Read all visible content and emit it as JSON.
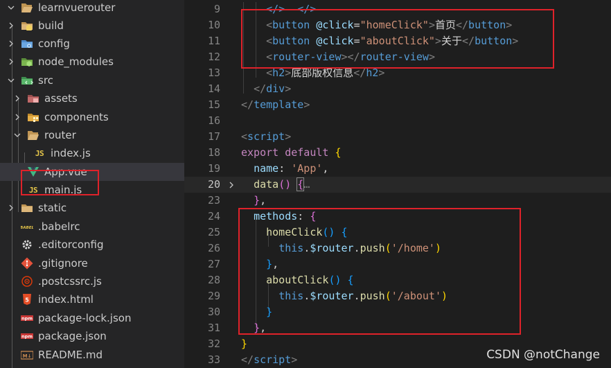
{
  "explorer": {
    "items": [
      {
        "label": "learnvuerouter",
        "chevron": "down",
        "icon": "folder-open-icon"
      },
      {
        "label": "build",
        "chevron": "right",
        "icon": "folder-build-icon"
      },
      {
        "label": "config",
        "chevron": "right",
        "icon": "folder-config-icon"
      },
      {
        "label": "node_modules",
        "chevron": "right",
        "icon": "folder-node-icon"
      },
      {
        "label": "src",
        "chevron": "down",
        "icon": "folder-src-icon"
      },
      {
        "label": "assets",
        "chevron": "right",
        "icon": "folder-assets-icon"
      },
      {
        "label": "components",
        "chevron": "right",
        "icon": "folder-components-icon"
      },
      {
        "label": "router",
        "chevron": "down",
        "icon": "folder-open-icon"
      },
      {
        "label": "index.js",
        "chevron": "",
        "icon": "js-file-icon",
        "badge": "JS"
      },
      {
        "label": "App.vue",
        "chevron": "",
        "icon": "vue-file-icon",
        "selected": true
      },
      {
        "label": "main.js",
        "chevron": "",
        "icon": "js-file-icon",
        "badge": "JS"
      },
      {
        "label": "static",
        "chevron": "right",
        "icon": "folder-icon"
      },
      {
        "label": ".babelrc",
        "chevron": "",
        "icon": "babel-file-icon",
        "badge": "BABEL"
      },
      {
        "label": ".editorconfig",
        "chevron": "",
        "icon": "gear-file-icon"
      },
      {
        "label": ".gitignore",
        "chevron": "",
        "icon": "git-file-icon"
      },
      {
        "label": ".postcssrc.js",
        "chevron": "",
        "icon": "postcss-file-icon"
      },
      {
        "label": "index.html",
        "chevron": "",
        "icon": "html-file-icon",
        "badge": "5"
      },
      {
        "label": "package-lock.json",
        "chevron": "",
        "icon": "npm-file-icon",
        "badge": "npm"
      },
      {
        "label": "package.json",
        "chevron": "",
        "icon": "npm-file-icon",
        "badge": "npm"
      },
      {
        "label": "README.md",
        "chevron": "",
        "icon": "markdown-file-icon",
        "badge": "M↓"
      }
    ]
  },
  "editor": {
    "lines": [
      {
        "n": "9",
        "tokens": [
          [
            "    ",
            "plain"
          ],
          [
            "</",
            "tag"
          ],
          [
            ">",
            "tag"
          ],
          [
            "  ",
            "plain"
          ],
          [
            "</",
            "tag"
          ],
          [
            ">",
            "tag"
          ]
        ]
      },
      {
        "n": "10",
        "tokens": [
          [
            "    ",
            "plain"
          ],
          [
            "<",
            "punct"
          ],
          [
            "button",
            "tag"
          ],
          [
            " ",
            "plain"
          ],
          [
            "@click",
            "attr"
          ],
          [
            "=",
            "plain"
          ],
          [
            "\"homeClick\"",
            "str-d"
          ],
          [
            ">",
            "punct"
          ],
          [
            "首页",
            "plain"
          ],
          [
            "</",
            "punct"
          ],
          [
            "button",
            "tag"
          ],
          [
            ">",
            "punct"
          ]
        ]
      },
      {
        "n": "11",
        "tokens": [
          [
            "    ",
            "plain"
          ],
          [
            "<",
            "punct"
          ],
          [
            "button",
            "tag"
          ],
          [
            " ",
            "plain"
          ],
          [
            "@click",
            "attr"
          ],
          [
            "=",
            "plain"
          ],
          [
            "\"aboutClick\"",
            "str-d"
          ],
          [
            ">",
            "punct"
          ],
          [
            "关于",
            "plain"
          ],
          [
            "</",
            "punct"
          ],
          [
            "button",
            "tag"
          ],
          [
            ">",
            "punct"
          ]
        ]
      },
      {
        "n": "12",
        "tokens": [
          [
            "    ",
            "plain"
          ],
          [
            "<",
            "punct"
          ],
          [
            "router-view",
            "tag"
          ],
          [
            ">",
            "punct"
          ],
          [
            "</",
            "punct"
          ],
          [
            "router-view",
            "tag"
          ],
          [
            ">",
            "punct"
          ]
        ]
      },
      {
        "n": "13",
        "tokens": [
          [
            "    ",
            "plain"
          ],
          [
            "<",
            "punct"
          ],
          [
            "h2",
            "tag"
          ],
          [
            ">",
            "punct"
          ],
          [
            "底部版权信息",
            "plain"
          ],
          [
            "</",
            "punct"
          ],
          [
            "h2",
            "tag"
          ],
          [
            ">",
            "punct"
          ]
        ]
      },
      {
        "n": "14",
        "tokens": [
          [
            "  ",
            "plain"
          ],
          [
            "</",
            "punct"
          ],
          [
            "div",
            "tag"
          ],
          [
            ">",
            "punct"
          ]
        ]
      },
      {
        "n": "15",
        "tokens": [
          [
            "</",
            "punct"
          ],
          [
            "template",
            "tag"
          ],
          [
            ">",
            "punct"
          ]
        ]
      },
      {
        "n": "16",
        "tokens": []
      },
      {
        "n": "17",
        "tokens": [
          [
            "<",
            "punct"
          ],
          [
            "script",
            "tag"
          ],
          [
            ">",
            "punct"
          ]
        ]
      },
      {
        "n": "18",
        "tokens": [
          [
            "export",
            "kw"
          ],
          [
            " ",
            "plain"
          ],
          [
            "default",
            "kw"
          ],
          [
            " ",
            "plain"
          ],
          [
            "{",
            "brace-y"
          ]
        ]
      },
      {
        "n": "19",
        "tokens": [
          [
            "  ",
            "plain"
          ],
          [
            "name",
            "prop"
          ],
          [
            ": ",
            "plain"
          ],
          [
            "'App'",
            "str-d"
          ],
          [
            ",",
            "plain"
          ]
        ]
      },
      {
        "n": "20",
        "current": true,
        "fold": true,
        "tokens": [
          [
            "  ",
            "plain"
          ],
          [
            "data",
            "fn"
          ],
          [
            "()",
            "brace-p"
          ],
          [
            " ",
            "plain"
          ],
          [
            "{",
            "brace-p"
          ],
          [
            "…",
            "dots"
          ]
        ]
      },
      {
        "n": "23",
        "tokens": [
          [
            "  ",
            "plain"
          ],
          [
            "}",
            "brace-p"
          ],
          [
            ",",
            "plain"
          ]
        ]
      },
      {
        "n": "24",
        "tokens": [
          [
            "  ",
            "plain"
          ],
          [
            "methods",
            "prop"
          ],
          [
            ": ",
            "plain"
          ],
          [
            "{",
            "brace-p"
          ]
        ]
      },
      {
        "n": "25",
        "tokens": [
          [
            "    ",
            "plain"
          ],
          [
            "homeClick",
            "fn"
          ],
          [
            "()",
            "brace-b"
          ],
          [
            " ",
            "plain"
          ],
          [
            "{",
            "brace-b"
          ]
        ]
      },
      {
        "n": "26",
        "tokens": [
          [
            "      ",
            "plain"
          ],
          [
            "this",
            "kw2"
          ],
          [
            ".",
            "plain"
          ],
          [
            "$router",
            "prop"
          ],
          [
            ".",
            "plain"
          ],
          [
            "push",
            "fn"
          ],
          [
            "(",
            "brace-y"
          ],
          [
            "'/home'",
            "str-d"
          ],
          [
            ")",
            "brace-y"
          ]
        ]
      },
      {
        "n": "27",
        "tokens": [
          [
            "    ",
            "plain"
          ],
          [
            "}",
            "brace-b"
          ],
          [
            ",",
            "plain"
          ]
        ]
      },
      {
        "n": "28",
        "tokens": [
          [
            "    ",
            "plain"
          ],
          [
            "aboutClick",
            "fn"
          ],
          [
            "()",
            "brace-b"
          ],
          [
            " ",
            "plain"
          ],
          [
            "{",
            "brace-b"
          ]
        ]
      },
      {
        "n": "29",
        "tokens": [
          [
            "      ",
            "plain"
          ],
          [
            "this",
            "kw2"
          ],
          [
            ".",
            "plain"
          ],
          [
            "$router",
            "prop"
          ],
          [
            ".",
            "plain"
          ],
          [
            "push",
            "fn"
          ],
          [
            "(",
            "brace-y"
          ],
          [
            "'/about'",
            "str-d"
          ],
          [
            ")",
            "brace-y"
          ]
        ]
      },
      {
        "n": "30",
        "tokens": [
          [
            "    ",
            "plain"
          ],
          [
            "}",
            "brace-b"
          ]
        ]
      },
      {
        "n": "31",
        "tokens": [
          [
            "  ",
            "plain"
          ],
          [
            "}",
            "brace-p"
          ],
          [
            ",",
            "plain"
          ]
        ]
      },
      {
        "n": "32",
        "tokens": [
          [
            "}",
            "brace-y"
          ]
        ]
      },
      {
        "n": "33",
        "tokens": [
          [
            "</",
            "punct"
          ],
          [
            "script",
            "tag"
          ],
          [
            ">",
            "punct"
          ]
        ]
      }
    ]
  },
  "watermark": "CSDN @notChange",
  "colors": {
    "sidebar_bg": "#252526",
    "editor_bg": "#1e1e1e",
    "highlight_box": "#e0222a",
    "selected_row": "#37373d"
  }
}
